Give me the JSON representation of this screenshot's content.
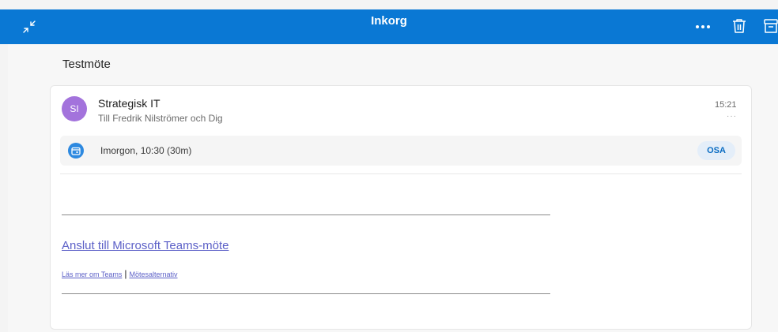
{
  "header": {
    "title": "Inkorg",
    "collapse_icon": "collapse-arrows-icon",
    "more_label": "•••",
    "trash_icon": "trash-icon",
    "archive_icon": "archive-icon",
    "background": "#0a78d4"
  },
  "thread": {
    "subject": "Testmöte"
  },
  "message": {
    "avatar_initials": "SI",
    "avatar_color": "#a373dc",
    "sender": "Strategisk IT",
    "recipients": "Till Fredrik Nilströmer och Dig",
    "time": "15:21",
    "more_label": "···"
  },
  "meeting": {
    "icon": "calendar-icon",
    "time_text": "Imorgon, 10:30 (30m)",
    "rsvp_label": "OSA"
  },
  "body": {
    "join_link": "Anslut till Microsoft Teams-möte",
    "learn_more_link": "Läs mer om Teams",
    "separator": "|",
    "options_link": "Mötesalternativ",
    "link_color": "#5b5fc7"
  }
}
